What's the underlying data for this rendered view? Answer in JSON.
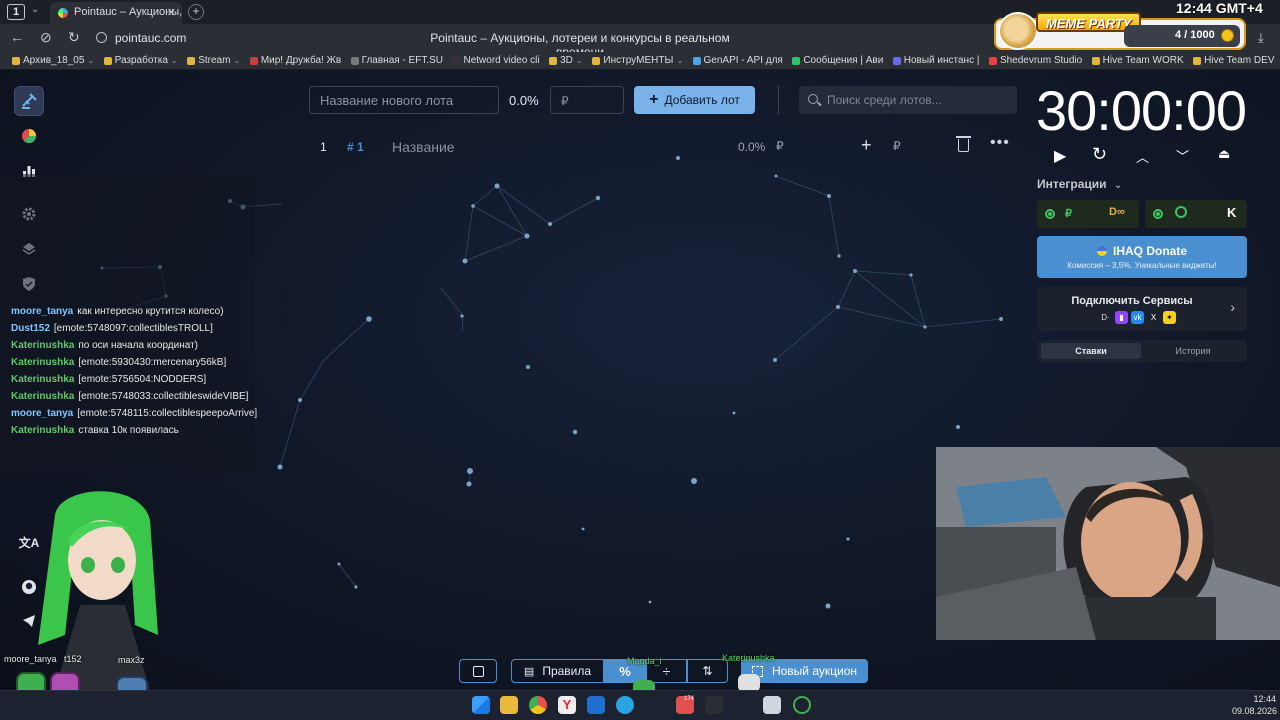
{
  "browser": {
    "tab_count": "1",
    "tab_title": "Pointauc – Аукционы, л",
    "url": "pointauc.com",
    "window_title": "Pointauc – Аукционы, лотереи и конкурсы в реальном времени",
    "bookmarks": [
      {
        "label": "Архив_18_05",
        "dd": true,
        "color": "#e2b542"
      },
      {
        "label": "Разработка",
        "dd": true,
        "color": "#e2b542"
      },
      {
        "label": "Stream",
        "dd": true,
        "color": "#e2b542"
      },
      {
        "label": "Мир! Дружба! Жв",
        "dd": false,
        "color": "#c94040"
      },
      {
        "label": "Главная - EFT.SU",
        "dd": false,
        "color": "#7a7a7a"
      },
      {
        "label": "Netword video cli",
        "dd": false,
        "color": "#333"
      },
      {
        "label": "3D",
        "dd": true,
        "color": "#e2b542"
      },
      {
        "label": "ИнструМЕНТЫ",
        "dd": true,
        "color": "#e2b542"
      },
      {
        "label": "GenAPI - API для",
        "dd": false,
        "color": "#4fa3e8"
      },
      {
        "label": "Сообщения | Ави",
        "dd": false,
        "color": "#35c16a"
      },
      {
        "label": "Новый инстанс |",
        "dd": false,
        "color": "#6a6ae8"
      },
      {
        "label": "Shedevrum Studio",
        "dd": false,
        "color": "#e84040"
      },
      {
        "label": "Hive Team WORK",
        "dd": false,
        "color": "#e2b542"
      },
      {
        "label": "Hive Team DEV",
        "dd": false,
        "color": "#e2b542"
      }
    ]
  },
  "overlay": {
    "clock": "12:44 GMT+4",
    "meme_title": "MEME PARTY",
    "meme_count": "4 / 1000"
  },
  "lot_form": {
    "name_placeholder": "Название нового лота",
    "percent": "0.0%",
    "amount_placeholder": "₽",
    "add_label": "Добавить лот",
    "search_placeholder": "Поиск среди лотов..."
  },
  "lot_row": {
    "num": "1",
    "tag": "# 1",
    "title": "Название",
    "percent": "0.0%",
    "currency": "₽",
    "currency2": "₽"
  },
  "chat": [
    {
      "user": "moore_tanya",
      "color": "#7fc7ff",
      "text": "как интересно крутится колесо)"
    },
    {
      "user": "Dust152",
      "color": "#7fc7ff",
      "text": "[emote:5748097:collectiblesTROLL]"
    },
    {
      "user": "Katerinushka",
      "color": "#5fc96a",
      "text": "по оси начала координат)"
    },
    {
      "user": "Katerinushka",
      "color": "#5fc96a",
      "text": "[emote:5930430:mercenary56kB]"
    },
    {
      "user": "Katerinushka",
      "color": "#5fc96a",
      "text": "[emote:5756504:NODDERS]"
    },
    {
      "user": "Katerinushka",
      "color": "#5fc96a",
      "text": "[emote:5748033:collectibleswideVIBE]"
    },
    {
      "user": "moore_tanya",
      "color": "#7fc7ff",
      "text": "[emote:5748115:collectiblespeepoArrive]"
    },
    {
      "user": "Katerinushka",
      "color": "#5fc96a",
      "text": "ставка 10к появилась"
    }
  ],
  "timer": {
    "value": "30:00:00"
  },
  "right_panel": {
    "integrations_label": "Интеграции",
    "donate_title": "IHAQ Donate",
    "donate_subtitle": "Комиссия – 3,5%. Уникальные виджеты!",
    "services_title": "Подключить Сервисы",
    "tab_bids": "Ставки",
    "tab_history": "История"
  },
  "bottom_bar": {
    "rules_label": "Правила",
    "new_auction_label": "Новый аукцион"
  },
  "stickers": {
    "name1": "moore_tanya",
    "name2": "t152",
    "name3": "max3z",
    "name4": "Magda_i",
    "name5": "Katerinushka"
  },
  "taskbar": {
    "time": "12:44",
    "date": "09.08.2026",
    "badge": "174"
  },
  "colors": {
    "accent": "#79b3ea",
    "primary_button": "#4a8fd0",
    "background": "#101726"
  }
}
